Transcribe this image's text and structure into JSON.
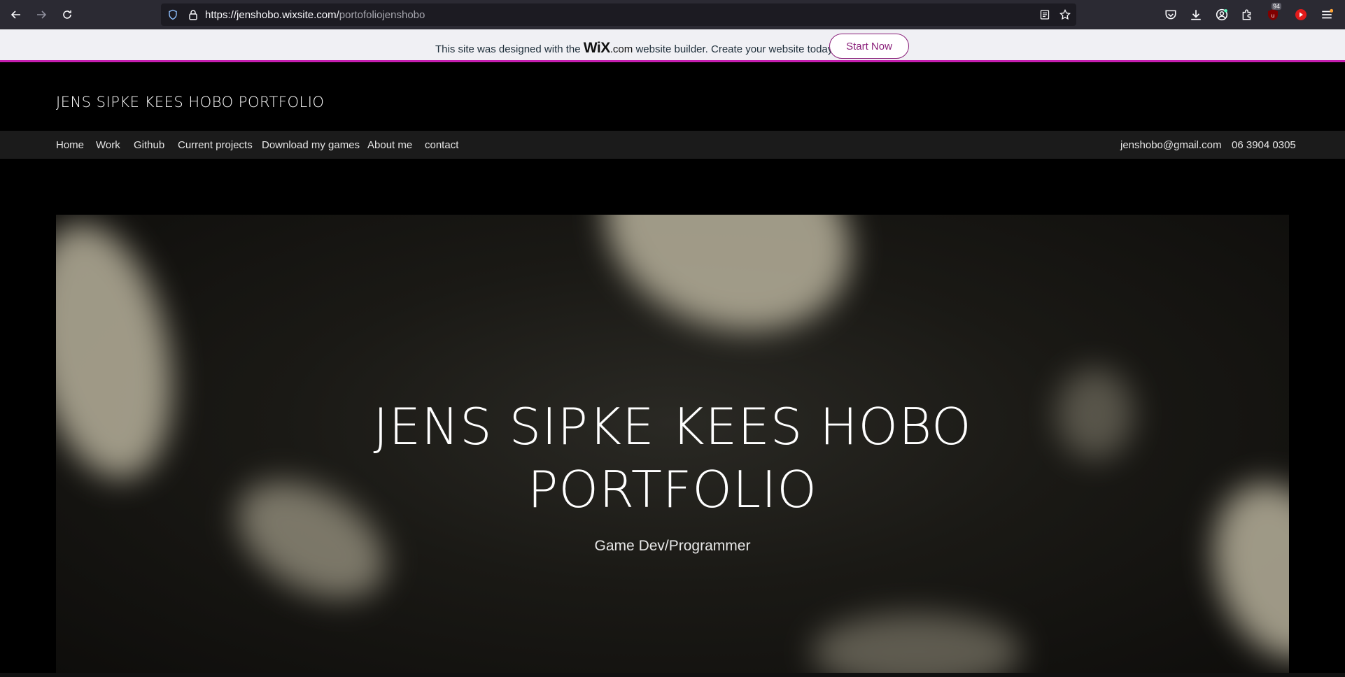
{
  "browser": {
    "url_host": "https://jenshobo.wixsite.com/",
    "url_path": "portofoliojenshobo",
    "notification_count": "94"
  },
  "wix_banner": {
    "text_before": "This site was designed with the ",
    "logo": "WiX",
    "logo_suffix": ".com",
    "text_after": " website builder. Create your website today.",
    "cta_label": "Start Now",
    "accent_color": "#c61eb0"
  },
  "header": {
    "site_title": "JENS SIPKE KEES HOBO PORTFOLIO"
  },
  "nav": {
    "items": [
      {
        "label": "Home"
      },
      {
        "label": "Work"
      },
      {
        "label": "Github"
      },
      {
        "label": "Current projects"
      },
      {
        "label": "Download my games"
      },
      {
        "label": "About me"
      },
      {
        "label": "contact"
      }
    ],
    "email": "jenshobo@gmail.com",
    "phone": "06 3904 0305"
  },
  "hero": {
    "title_line1": "JENS SIPKE KEES HOBO",
    "title_line2": "PORTFOLIO",
    "subtitle": "Game Dev/Programmer"
  }
}
